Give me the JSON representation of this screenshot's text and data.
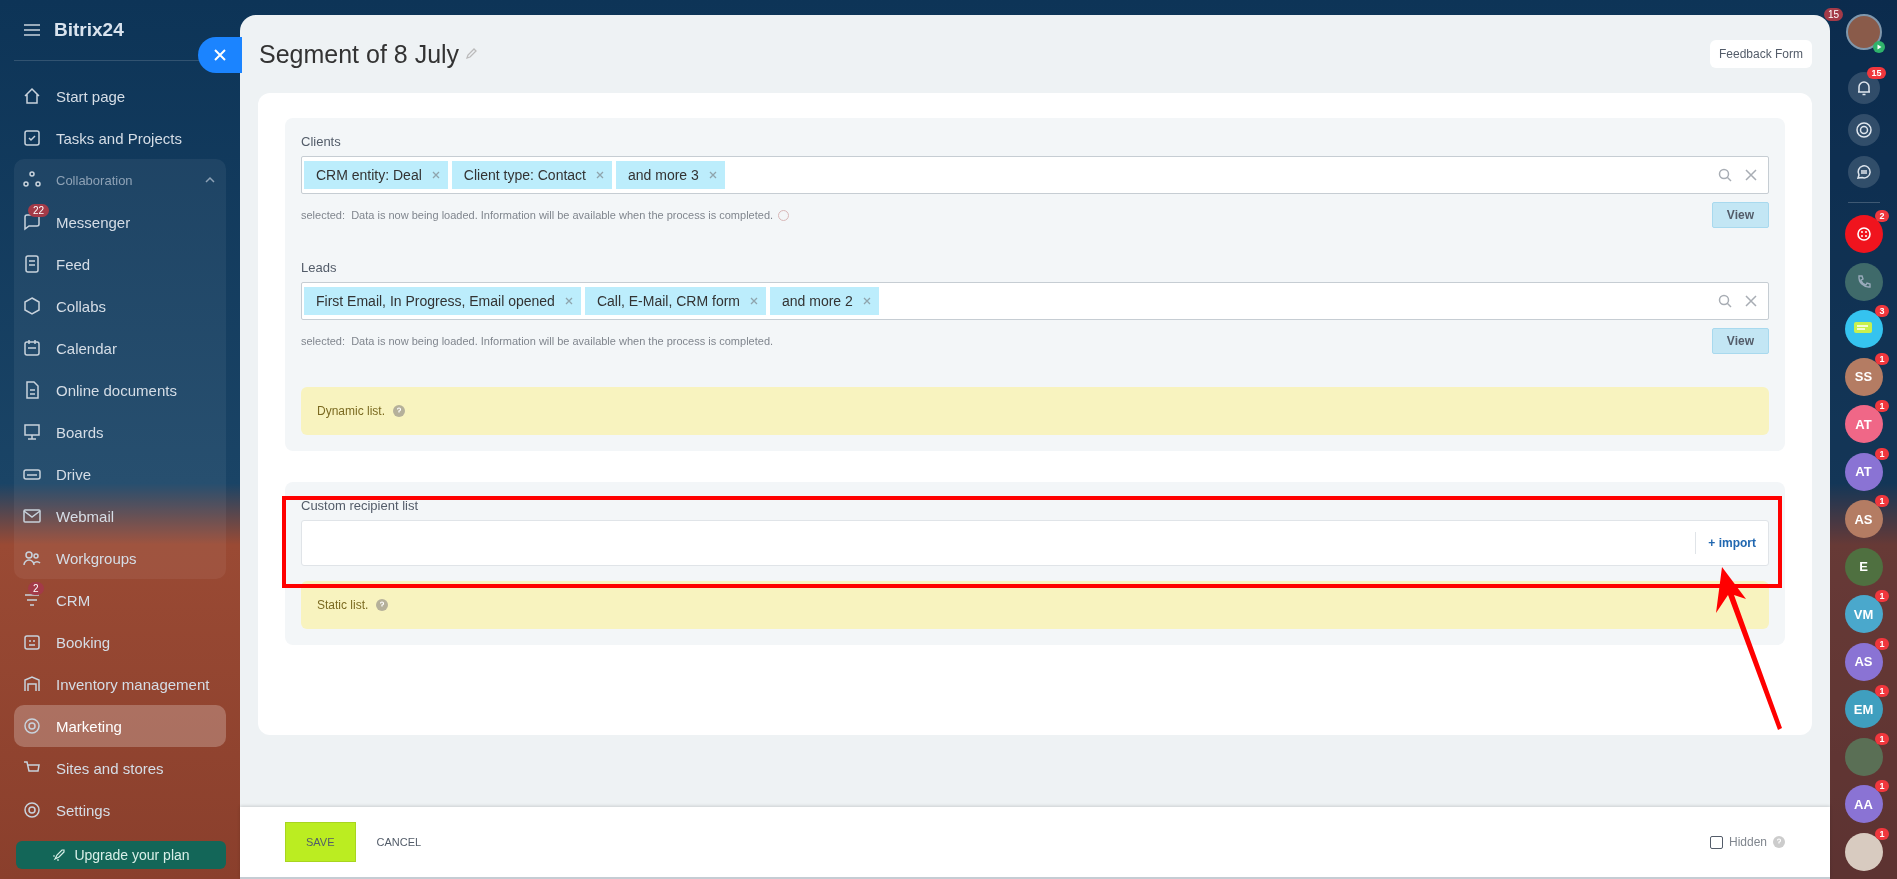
{
  "sidebar": {
    "logo": "Bitrix24",
    "items": [
      {
        "label": "Start page",
        "selected": false
      },
      {
        "label": "Tasks and Projects",
        "selected": false
      },
      {
        "label": "Collaboration",
        "expanded": true,
        "children": [
          {
            "label": "Messenger",
            "selected": false,
            "badge": "22"
          },
          {
            "label": "Feed",
            "selected": false
          },
          {
            "label": "Collabs",
            "selected": false
          },
          {
            "label": "Calendar",
            "selected": false
          },
          {
            "label": "Online documents",
            "selected": false
          },
          {
            "label": "Boards",
            "selected": false
          },
          {
            "label": "Drive",
            "selected": false
          },
          {
            "label": "Webmail",
            "selected": false
          },
          {
            "label": "Workgroups",
            "selected": false
          }
        ]
      },
      {
        "label": "CRM",
        "selected": false,
        "badge": "2"
      },
      {
        "label": "Booking",
        "selected": false
      },
      {
        "label": "Inventory management",
        "selected": false
      },
      {
        "label": "Marketing",
        "selected": true
      },
      {
        "label": "Sites and stores",
        "selected": false
      },
      {
        "label": "Settings",
        "selected": false
      }
    ],
    "upgrade_button": "Upgrade your plan"
  },
  "slider": {
    "title": "Segment of 8 July",
    "feedback_button": "Feedback Form",
    "filters": [
      {
        "label": "Clients",
        "tags": [
          "CRM entity: Deal",
          "Client type: Contact",
          "and more 3"
        ],
        "status_prefix": "selected:",
        "status": "Data is now being loaded. Information will be available when the process is completed.",
        "loading": true,
        "view_button": "View"
      },
      {
        "label": "Leads",
        "tags": [
          "First Email, In Progress, Email opened",
          "Call, E-Mail, CRM form",
          "and more 2"
        ],
        "status_prefix": "selected:",
        "status": "Data is now being loaded. Information will be available when the process is completed.",
        "loading": false,
        "view_button": "View"
      }
    ],
    "dynamic_note": "Dynamic list.",
    "custom_list": {
      "label": "Custom recipient list",
      "import_button": "+ import"
    },
    "static_note": "Static list.",
    "footer": {
      "save_button": "SAVE",
      "cancel_button": "CANCEL",
      "hidden": {
        "label": "Hidden",
        "checked": false
      }
    }
  },
  "rail": {
    "top_badge": "15",
    "notifications_badge": "15",
    "contacts": [
      {
        "kind": "twilio",
        "badge": "2",
        "color": "#f0141e"
      },
      {
        "kind": "phone",
        "color": "#3f6a6a"
      },
      {
        "kind": "chat",
        "badge": "3",
        "color": "#35c3ef"
      },
      {
        "kind": "initials",
        "initials": "SS",
        "badge": "1",
        "color": "#b47c63"
      },
      {
        "kind": "initials",
        "initials": "AT",
        "badge": "1",
        "color": "#f06787"
      },
      {
        "kind": "initials",
        "initials": "AT",
        "badge": "1",
        "color": "#8a73d4"
      },
      {
        "kind": "initials",
        "initials": "AS",
        "badge": "1",
        "color": "#b47c63"
      },
      {
        "kind": "initials",
        "initials": "E",
        "color": "#4f7040"
      },
      {
        "kind": "initials",
        "initials": "VM",
        "badge": "1",
        "color": "#4aa8cc"
      },
      {
        "kind": "initials",
        "initials": "AS",
        "badge": "1",
        "color": "#8a73d4"
      },
      {
        "kind": "initials",
        "initials": "EM",
        "badge": "1",
        "color": "#3f9fbf"
      },
      {
        "kind": "photo",
        "badge": "1",
        "color": "#5a6f55"
      },
      {
        "kind": "initials",
        "initials": "AA",
        "badge": "1",
        "color": "#8a73d4"
      },
      {
        "kind": "photo",
        "badge": "1",
        "color": "#d8cbc0"
      }
    ]
  }
}
